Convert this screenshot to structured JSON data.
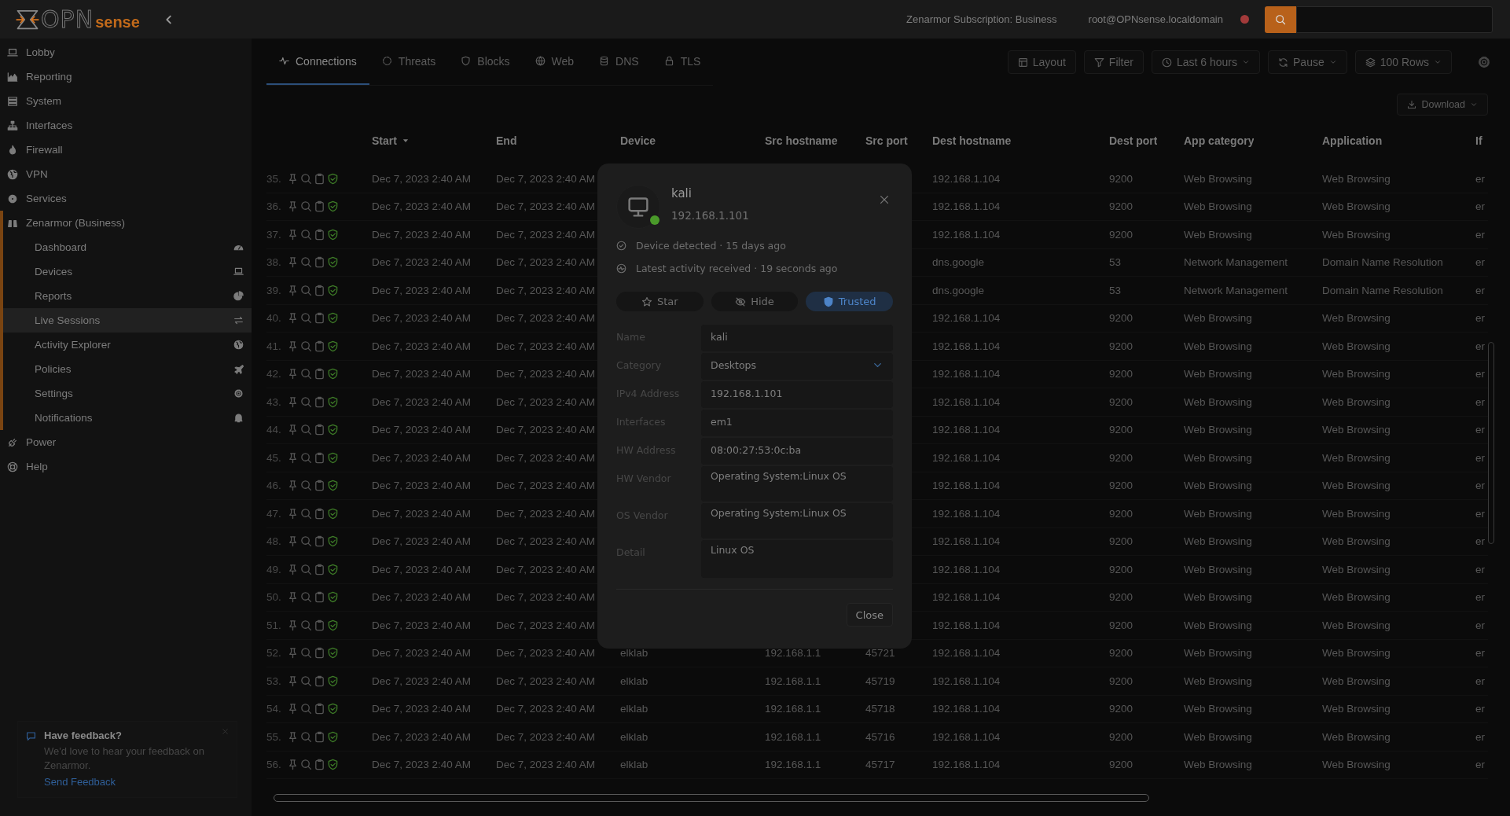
{
  "topbar": {
    "logo": {
      "part_1": "OPN",
      "part_2": "sense"
    },
    "subscription": "Zenarmor Subscription: Business",
    "user": "root@OPNsense.localdomain"
  },
  "sidebar": {
    "items": [
      {
        "label": "Lobby",
        "expanded": false
      },
      {
        "label": "Reporting",
        "expanded": false
      },
      {
        "label": "System",
        "expanded": false
      },
      {
        "label": "Interfaces",
        "expanded": false
      },
      {
        "label": "Firewall",
        "expanded": false
      },
      {
        "label": "VPN",
        "expanded": false
      },
      {
        "label": "Services",
        "expanded": false
      },
      {
        "label": "Zenarmor (Business)",
        "expanded": true,
        "children": [
          {
            "label": "Dashboard",
            "selected": false
          },
          {
            "label": "Devices",
            "selected": false
          },
          {
            "label": "Reports",
            "selected": false
          },
          {
            "label": "Live Sessions",
            "selected": true
          },
          {
            "label": "Activity Explorer",
            "selected": false
          },
          {
            "label": "Policies",
            "selected": false
          },
          {
            "label": "Settings",
            "selected": false
          },
          {
            "label": "Notifications",
            "selected": false
          }
        ]
      },
      {
        "label": "Power",
        "expanded": false
      },
      {
        "label": "Help",
        "expanded": false
      }
    ]
  },
  "feedback": {
    "title": "Have feedback?",
    "text": "We'd love to hear your feedback on Zenarmor.",
    "link": "Send Feedback"
  },
  "tabs": [
    {
      "label": "Connections",
      "selected": true
    },
    {
      "label": "Threats",
      "selected": false
    },
    {
      "label": "Blocks",
      "selected": false
    },
    {
      "label": "Web",
      "selected": false
    },
    {
      "label": "DNS",
      "selected": false
    },
    {
      "label": "TLS",
      "selected": false
    }
  ],
  "toolbar": [
    {
      "label": "Layout",
      "kind": "button"
    },
    {
      "label": "Filter",
      "kind": "button"
    },
    {
      "label": "Last 6 hours",
      "kind": "dropdown"
    },
    {
      "label": "Pause",
      "kind": "dropdown"
    },
    {
      "label": "100 Rows",
      "kind": "dropdown"
    }
  ],
  "download_button": "Download",
  "table": {
    "columns": [
      {
        "label": "Start",
        "sorted": true
      },
      {
        "label": "End",
        "sorted": false
      },
      {
        "label": "Device",
        "sorted": false
      },
      {
        "label": "Src hostname",
        "sorted": false
      },
      {
        "label": "Src port",
        "sorted": false
      },
      {
        "label": "Dest hostname",
        "sorted": false
      },
      {
        "label": "Dest port",
        "sorted": false
      },
      {
        "label": "App category",
        "sorted": false
      },
      {
        "label": "Application",
        "sorted": false
      },
      {
        "label": "If",
        "sorted": false
      }
    ],
    "rows": [
      {
        "number": "35.",
        "start": "Dec 7, 2023 2:40 AM",
        "end": "Dec 7, 2023 2:40 AM",
        "dest_hostname": "192.168.1.104",
        "dest_port": "9200",
        "app_category": "Web Browsing",
        "application": "Web Browsing",
        "column_11": "er"
      },
      {
        "number": "36.",
        "start": "Dec 7, 2023 2:40 AM",
        "end": "Dec 7, 2023 2:40 AM",
        "dest_hostname": "192.168.1.104",
        "dest_port": "9200",
        "app_category": "Web Browsing",
        "application": "Web Browsing",
        "column_11": "er"
      },
      {
        "number": "37.",
        "start": "Dec 7, 2023 2:40 AM",
        "end": "Dec 7, 2023 2:40 AM",
        "dest_hostname": "192.168.1.104",
        "dest_port": "9200",
        "app_category": "Web Browsing",
        "application": "Web Browsing",
        "column_11": "er"
      },
      {
        "number": "38.",
        "start": "Dec 7, 2023 2:40 AM",
        "end": "Dec 7, 2023 2:40 AM",
        "dest_hostname": "dns.google",
        "dest_port": "53",
        "app_category": "Network Management",
        "application": "Domain Name Resolution",
        "column_11": "er"
      },
      {
        "number": "39.",
        "start": "Dec 7, 2023 2:40 AM",
        "end": "Dec 7, 2023 2:40 AM",
        "dest_hostname": "dns.google",
        "dest_port": "53",
        "app_category": "Network Management",
        "application": "Domain Name Resolution",
        "column_11": "er"
      },
      {
        "number": "40.",
        "start": "Dec 7, 2023 2:40 AM",
        "end": "Dec 7, 2023 2:40 AM",
        "dest_hostname": "192.168.1.104",
        "dest_port": "9200",
        "app_category": "Web Browsing",
        "application": "Web Browsing",
        "column_11": "er"
      },
      {
        "number": "41.",
        "start": "Dec 7, 2023 2:40 AM",
        "end": "Dec 7, 2023 2:40 AM",
        "dest_hostname": "192.168.1.104",
        "dest_port": "9200",
        "app_category": "Web Browsing",
        "application": "Web Browsing",
        "column_11": "er"
      },
      {
        "number": "42.",
        "start": "Dec 7, 2023 2:40 AM",
        "end": "Dec 7, 2023 2:40 AM",
        "dest_hostname": "192.168.1.104",
        "dest_port": "9200",
        "app_category": "Web Browsing",
        "application": "Web Browsing",
        "column_11": "er"
      },
      {
        "number": "43.",
        "start": "Dec 7, 2023 2:40 AM",
        "end": "Dec 7, 2023 2:40 AM",
        "dest_hostname": "192.168.1.104",
        "dest_port": "9200",
        "app_category": "Web Browsing",
        "application": "Web Browsing",
        "column_11": "er"
      },
      {
        "number": "44.",
        "start": "Dec 7, 2023 2:40 AM",
        "end": "Dec 7, 2023 2:40 AM",
        "dest_hostname": "192.168.1.104",
        "dest_port": "9200",
        "app_category": "Web Browsing",
        "application": "Web Browsing",
        "column_11": "er"
      },
      {
        "number": "45.",
        "start": "Dec 7, 2023 2:40 AM",
        "end": "Dec 7, 2023 2:40 AM",
        "dest_hostname": "192.168.1.104",
        "dest_port": "9200",
        "app_category": "Web Browsing",
        "application": "Web Browsing",
        "column_11": "er"
      },
      {
        "number": "46.",
        "start": "Dec 7, 2023 2:40 AM",
        "end": "Dec 7, 2023 2:40 AM",
        "dest_hostname": "192.168.1.104",
        "dest_port": "9200",
        "app_category": "Web Browsing",
        "application": "Web Browsing",
        "column_11": "er"
      },
      {
        "number": "47.",
        "start": "Dec 7, 2023 2:40 AM",
        "end": "Dec 7, 2023 2:40 AM",
        "dest_hostname": "192.168.1.104",
        "dest_port": "9200",
        "app_category": "Web Browsing",
        "application": "Web Browsing",
        "column_11": "er"
      },
      {
        "number": "48.",
        "start": "Dec 7, 2023 2:40 AM",
        "end": "Dec 7, 2023 2:40 AM",
        "dest_hostname": "192.168.1.104",
        "dest_port": "9200",
        "app_category": "Web Browsing",
        "application": "Web Browsing",
        "column_11": "er"
      },
      {
        "number": "49.",
        "start": "Dec 7, 2023 2:40 AM",
        "end": "Dec 7, 2023 2:40 AM",
        "dest_hostname": "192.168.1.104",
        "dest_port": "9200",
        "app_category": "Web Browsing",
        "application": "Web Browsing",
        "column_11": "er"
      },
      {
        "number": "50.",
        "start": "Dec 7, 2023 2:40 AM",
        "end": "Dec 7, 2023 2:40 AM",
        "dest_hostname": "192.168.1.104",
        "dest_port": "9200",
        "app_category": "Web Browsing",
        "application": "Web Browsing",
        "column_11": "er"
      },
      {
        "number": "51.",
        "start": "Dec 7, 2023 2:40 AM",
        "end": "Dec 7, 2023 2:40 AM",
        "dest_hostname": "192.168.1.104",
        "dest_port": "9200",
        "app_category": "Web Browsing",
        "application": "Web Browsing",
        "column_11": "er"
      },
      {
        "number": "52.",
        "start": "Dec 7, 2023 2:40 AM",
        "end": "Dec 7, 2023 2:40 AM",
        "device": "elklab",
        "src_hostname": "192.168.1.1",
        "src_port": "45721",
        "dest_hostname": "192.168.1.104",
        "dest_port": "9200",
        "app_category": "Web Browsing",
        "application": "Web Browsing",
        "column_11": "er"
      },
      {
        "number": "53.",
        "start": "Dec 7, 2023 2:40 AM",
        "end": "Dec 7, 2023 2:40 AM",
        "device": "elklab",
        "src_hostname": "192.168.1.1",
        "src_port": "45719",
        "dest_hostname": "192.168.1.104",
        "dest_port": "9200",
        "app_category": "Web Browsing",
        "application": "Web Browsing",
        "column_11": "er"
      },
      {
        "number": "54.",
        "start": "Dec 7, 2023 2:40 AM",
        "end": "Dec 7, 2023 2:40 AM",
        "device": "elklab",
        "src_hostname": "192.168.1.1",
        "src_port": "45718",
        "dest_hostname": "192.168.1.104",
        "dest_port": "9200",
        "app_category": "Web Browsing",
        "application": "Web Browsing",
        "column_11": "er"
      },
      {
        "number": "55.",
        "start": "Dec 7, 2023 2:40 AM",
        "end": "Dec 7, 2023 2:40 AM",
        "device": "elklab",
        "src_hostname": "192.168.1.1",
        "src_port": "45716",
        "dest_hostname": "192.168.1.104",
        "dest_port": "9200",
        "app_category": "Web Browsing",
        "application": "Web Browsing",
        "column_11": "er"
      },
      {
        "number": "56.",
        "start": "Dec 7, 2023 2:40 AM",
        "end": "Dec 7, 2023 2:40 AM",
        "device": "elklab",
        "src_hostname": "192.168.1.1",
        "src_port": "45717",
        "dest_hostname": "192.168.1.104",
        "dest_port": "9200",
        "app_category": "Web Browsing",
        "application": "Web Browsing",
        "column_11": "er"
      }
    ]
  },
  "device_dialog": {
    "name": "kali",
    "ip": "192.168.1.101",
    "online": true,
    "events": [
      "Device detected · 15 days ago",
      "Latest activity received · 19 seconds ago"
    ],
    "toggles": [
      {
        "label": "Star",
        "selected": false
      },
      {
        "label": "Hide",
        "selected": false
      },
      {
        "label": "Trusted",
        "selected": true
      }
    ],
    "fields": [
      {
        "label": "Name",
        "kind": "input",
        "value": "kali"
      },
      {
        "label": "Category",
        "kind": "select",
        "value": "Desktops"
      },
      {
        "label": "IPv4 Address",
        "kind": "input",
        "value": "192.168.1.101"
      },
      {
        "label": "Interfaces",
        "kind": "input",
        "value": "em1"
      },
      {
        "label": "HW Address",
        "kind": "input",
        "value": "08:00:27:53:0c:ba"
      },
      {
        "label": "HW Vendor",
        "kind": "textarea",
        "value": "Operating System:Linux OS"
      },
      {
        "label": "OS Vendor",
        "kind": "textarea",
        "value": "Operating System:Linux OS"
      },
      {
        "label": "Detail",
        "kind": "textarea",
        "value": "Linux OS"
      }
    ],
    "close_button": "Close"
  }
}
